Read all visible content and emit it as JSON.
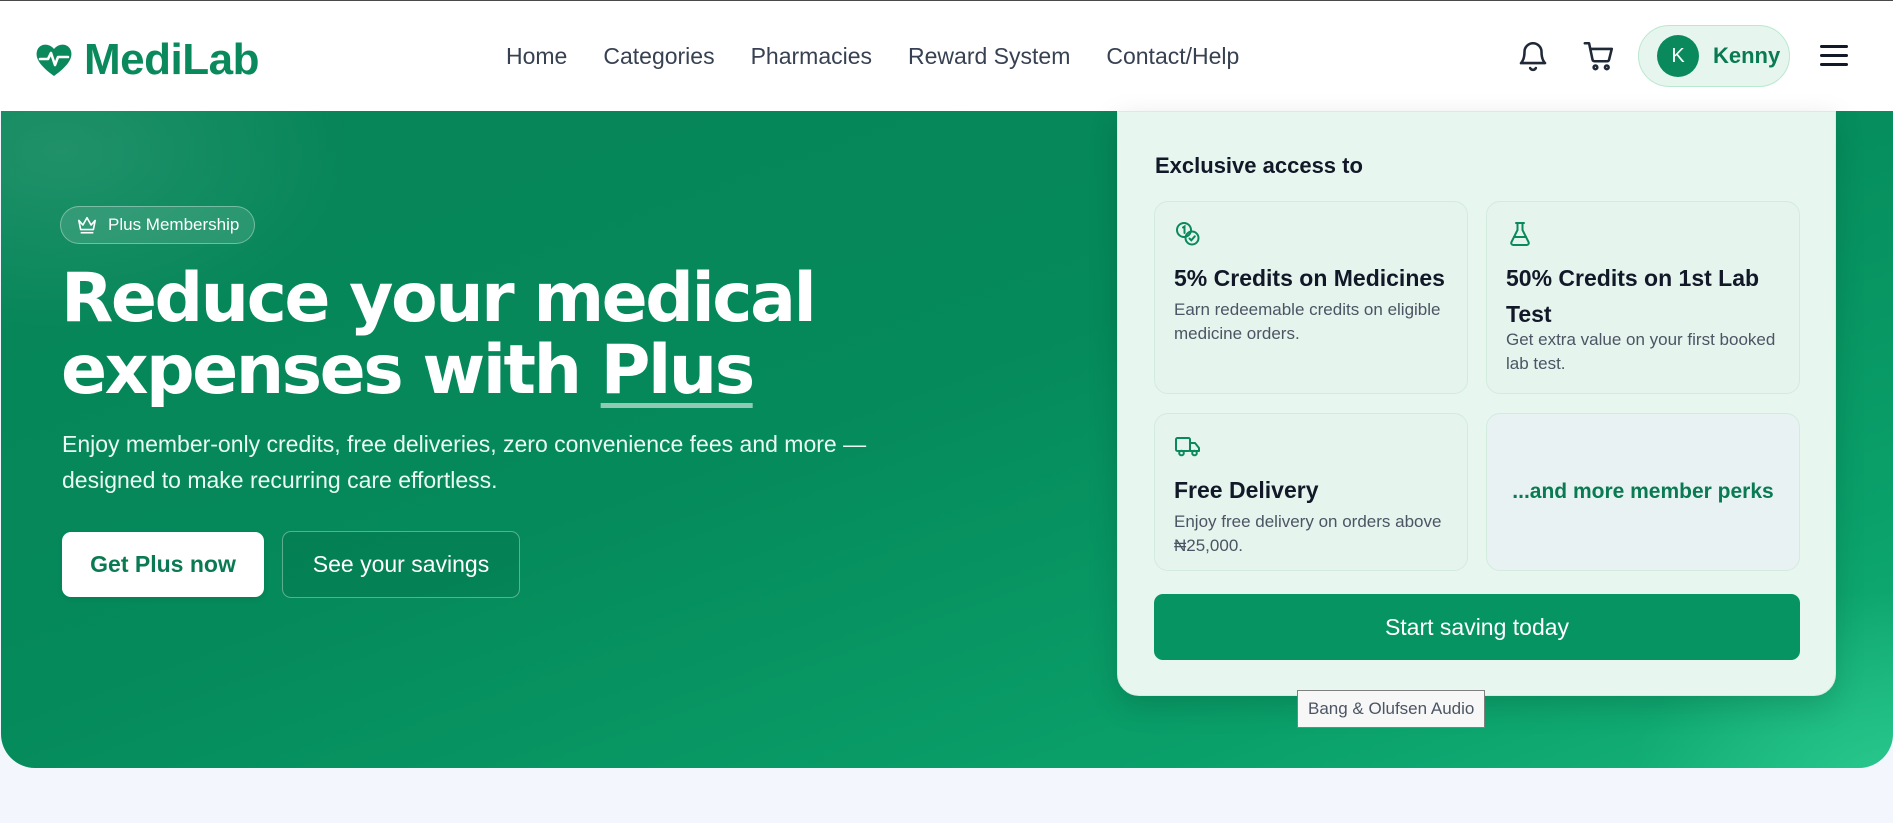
{
  "brand": {
    "name": "MediLab",
    "color": "#0a8a5c"
  },
  "nav": {
    "items": [
      "Home",
      "Categories",
      "Pharmacies",
      "Reward System",
      "Contact/Help"
    ]
  },
  "header_icons": {
    "notifications": "bell-icon",
    "cart": "cart-icon",
    "menu": "hamburger-menu-icon"
  },
  "user": {
    "initial": "K",
    "name": "Kenny"
  },
  "hero": {
    "badge": "Plus Membership",
    "title_line1": "Reduce your medical",
    "title_line2_prefix": "expenses with ",
    "title_highlight": "Plus",
    "subtitle": "Enjoy member-only credits, free deliveries, zero convenience fees and more — designed to make recurring care effortless.",
    "primary_button": "Get Plus now",
    "secondary_button": "See your savings"
  },
  "card": {
    "title": "Exclusive access to",
    "perks": [
      {
        "icon": "coins-icon",
        "title": "5% Credits on Medicines",
        "description": "Earn redeemable credits on eligible medicine orders."
      },
      {
        "icon": "flask-icon",
        "title": "50% Credits on 1st Lab Test",
        "description": "Get extra value on your first booked lab test."
      },
      {
        "icon": "truck-icon",
        "title": "Free Delivery",
        "description": "Enjoy free delivery on orders above ₦25,000."
      }
    ],
    "more": "...and more member perks",
    "cta": "Start saving today"
  },
  "tooltip": "Bang & Olufsen Audio",
  "colors": {
    "hero_green": "#058a5b",
    "accent": "#079463",
    "card_bg": "#e7f6ef"
  }
}
